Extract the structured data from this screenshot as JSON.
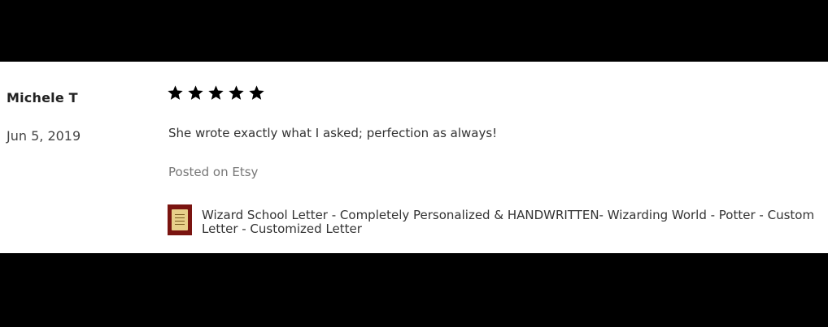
{
  "review": {
    "reviewer": "Michele T",
    "date": "Jun 5, 2019",
    "rating": 5,
    "rating_max": 5,
    "text": "She wrote exactly what I asked; perfection as always!",
    "source": "Posted on Etsy",
    "product_title": "Wizard School Letter - Completely Personalized & HANDWRITTEN- Wizarding World - Potter - Custom Letter - Customized Letter",
    "product_icon": "product-thumbnail",
    "star_icon": "star-icon",
    "star_color": "#000000"
  }
}
